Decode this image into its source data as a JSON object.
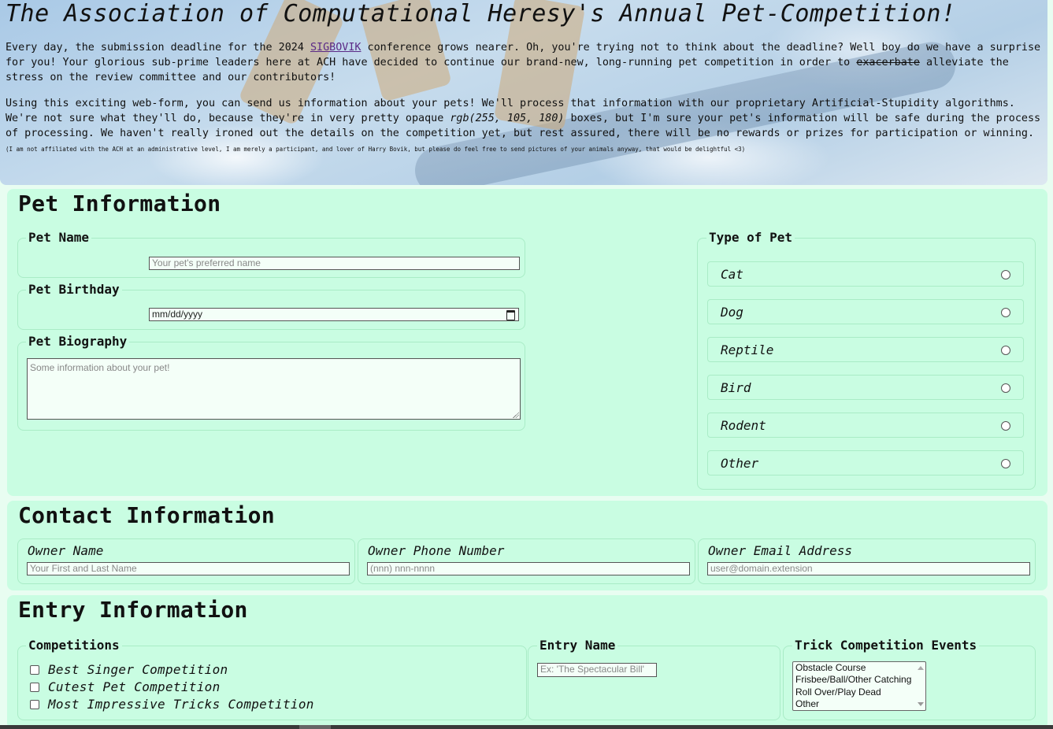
{
  "header": {
    "title": "The Association of Computational Heresy's Annual Pet-Competition!",
    "p1_a": "Every day, the submission deadline for the 2024 ",
    "p1_link": "SIGBOVIK",
    "p1_b": " conference grows nearer. Oh, you're trying not to think about the deadline? Well boy do we have a surprise for you! Your glorious sub-prime leaders here at ACH have decided to continue our brand-new, long-running pet competition in order to ",
    "p1_strike": "exacerbate",
    "p1_c": " alleviate the stress on the review committee and our contributors!",
    "p2_a": "Using this exciting web-form, you can send us information about your pets! We'll process that information with our proprietary Artificial-Stupidity algorithms. We're not sure what they'll do, because they're in very pretty opaque ",
    "p2_em": "rgb(255, 105, 180)",
    "p2_b": " boxes, but I'm sure your pet's information will be safe during the process of processing. We haven't really ironed out the details on the competition yet, but rest assured, there will be no rewards or prizes for participation or winning. ",
    "p2_small": "(I am not affiliated with the ACH at an administrative level, I am merely a participant, and lover of Harry Bovik, but please do feel free to send pictures of your animals anyway, that would be delightful <3)"
  },
  "pet_info": {
    "title": "Pet Information",
    "name_legend": "Pet Name",
    "name_placeholder": "Your pet's preferred name",
    "birthday_legend": "Pet Birthday",
    "birthday_value": "mm/dd/yyyy",
    "bio_legend": "Pet Biography",
    "bio_placeholder": "Some information about your pet!",
    "type_legend": "Type of Pet",
    "types": [
      "Cat",
      "Dog",
      "Reptile",
      "Bird",
      "Rodent",
      "Other"
    ]
  },
  "contact_info": {
    "title": "Contact Information",
    "owner_name_legend": "Owner Name",
    "owner_name_placeholder": "Your First and Last Name",
    "phone_legend": "Owner Phone Number",
    "phone_placeholder": "(nnn) nnn-nnnn",
    "email_legend": "Owner Email Address",
    "email_placeholder": "user@domain.extension"
  },
  "entry_info": {
    "title": "Entry Information",
    "competitions_legend": "Competitions",
    "competitions": [
      "Best Singer Competition",
      "Cutest Pet Competition",
      "Most Impressive Tricks Competition"
    ],
    "entry_name_legend": "Entry Name",
    "entry_name_placeholder": "Ex: 'The Spectacular Bill'",
    "trick_legend": "Trick Competition Events",
    "trick_events": [
      "Obstacle Course",
      "Frisbee/Ball/Other Catching",
      "Roll Over/Play Dead",
      "Other"
    ]
  },
  "colors": {
    "page_bg": "#e8fdf1",
    "section_bg": "#c9fde2",
    "section_border": "#a9ecc6",
    "link": "#5b2a86"
  }
}
